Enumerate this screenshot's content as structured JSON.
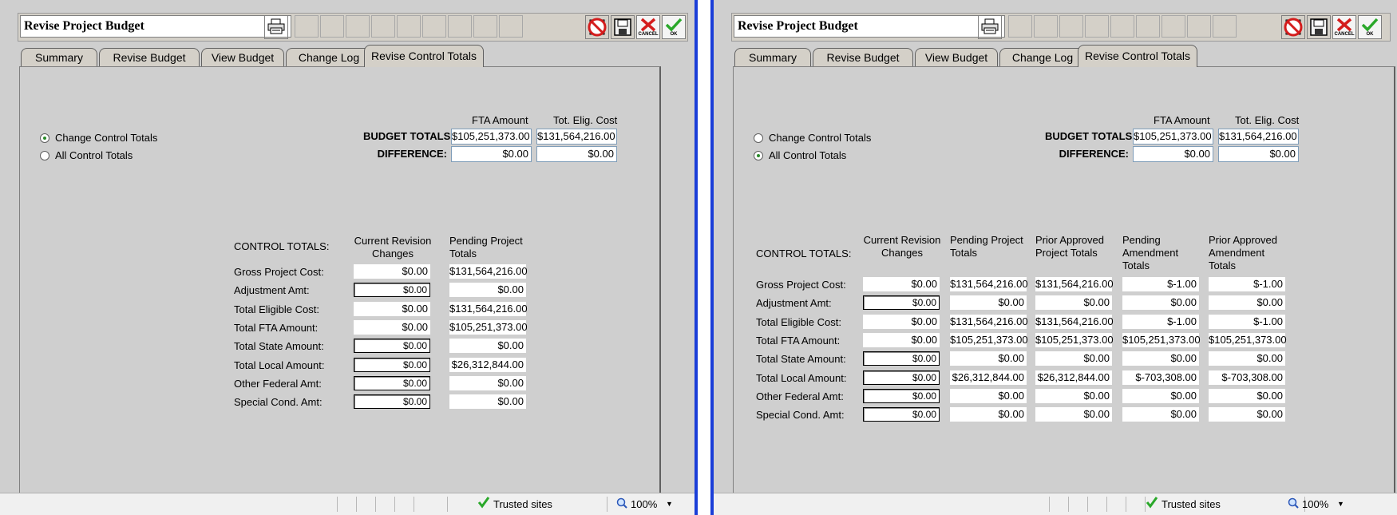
{
  "windows": [
    {
      "title": "Revise Project Budget",
      "tabs": [
        "Summary",
        "Revise Budget",
        "View Budget",
        "Change Log",
        "Revise Control Totals"
      ],
      "active_tab": 4,
      "radios": [
        {
          "label": "Change Control Totals",
          "selected": true
        },
        {
          "label": "All Control Totals",
          "selected": false
        }
      ],
      "budget": {
        "col_fta": "FTA Amount",
        "col_elig": "Tot. Elig. Cost",
        "totals_label": "BUDGET TOTALS:",
        "totals_fta": "$105,251,373.00",
        "totals_elig": "$131,564,216.00",
        "diff_label": "DIFFERENCE:",
        "diff_fta": "$0.00",
        "diff_elig": "$0.00"
      },
      "control": {
        "label": "CONTROL TOTALS:",
        "headers": [
          "Current Revision Changes",
          "Pending Project Totals"
        ],
        "rows": [
          {
            "label": "Gross Project Cost:",
            "values": [
              "$0.00",
              "$131,564,216.00"
            ],
            "editable": false
          },
          {
            "label": "Adjustment Amt:",
            "values": [
              "$0.00",
              "$0.00"
            ],
            "editable": true
          },
          {
            "label": "Total Eligible Cost:",
            "values": [
              "$0.00",
              "$131,564,216.00"
            ],
            "editable": false
          },
          {
            "label": "Total FTA Amount:",
            "values": [
              "$0.00",
              "$105,251,373.00"
            ],
            "editable": false
          },
          {
            "label": "Total State Amount:",
            "values": [
              "$0.00",
              "$0.00"
            ],
            "editable": true
          },
          {
            "label": "Total Local Amount:",
            "values": [
              "$0.00",
              "$26,312,844.00"
            ],
            "editable": true
          },
          {
            "label": "Other Federal Amt:",
            "values": [
              "$0.00",
              "$0.00"
            ],
            "editable": true
          },
          {
            "label": "Special Cond. Amt:",
            "values": [
              "$0.00",
              "$0.00"
            ],
            "editable": true
          }
        ]
      },
      "status": {
        "zone": "Trusted sites",
        "zoom": "100%"
      }
    },
    {
      "title": "Revise Project Budget",
      "tabs": [
        "Summary",
        "Revise Budget",
        "View Budget",
        "Change Log",
        "Revise Control Totals"
      ],
      "active_tab": 4,
      "radios": [
        {
          "label": "Change Control Totals",
          "selected": false
        },
        {
          "label": "All Control Totals",
          "selected": true
        }
      ],
      "budget": {
        "col_fta": "FTA Amount",
        "col_elig": "Tot. Elig. Cost",
        "totals_label": "BUDGET TOTALS:",
        "totals_fta": "$105,251,373.00",
        "totals_elig": "$131,564,216.00",
        "diff_label": "DIFFERENCE:",
        "diff_fta": "$0.00",
        "diff_elig": "$0.00"
      },
      "control": {
        "label": "CONTROL TOTALS:",
        "headers": [
          "Current Revision Changes",
          "Pending Project Totals",
          "Prior Approved Project Totals",
          "Pending Amendment Totals",
          "Prior Approved Amendment Totals"
        ],
        "rows": [
          {
            "label": "Gross Project Cost:",
            "values": [
              "$0.00",
              "$131,564,216.00",
              "$131,564,216.00",
              "$-1.00",
              "$-1.00"
            ],
            "editable": false
          },
          {
            "label": "Adjustment Amt:",
            "values": [
              "$0.00",
              "$0.00",
              "$0.00",
              "$0.00",
              "$0.00"
            ],
            "editable": true
          },
          {
            "label": "Total Eligible Cost:",
            "values": [
              "$0.00",
              "$131,564,216.00",
              "$131,564,216.00",
              "$-1.00",
              "$-1.00"
            ],
            "editable": false
          },
          {
            "label": "Total FTA Amount:",
            "values": [
              "$0.00",
              "$105,251,373.00",
              "$105,251,373.00",
              "$105,251,373.00",
              "$105,251,373.00"
            ],
            "editable": false
          },
          {
            "label": "Total State Amount:",
            "values": [
              "$0.00",
              "$0.00",
              "$0.00",
              "$0.00",
              "$0.00"
            ],
            "editable": true
          },
          {
            "label": "Total Local Amount:",
            "values": [
              "$0.00",
              "$26,312,844.00",
              "$26,312,844.00",
              "$-703,308.00",
              "$-703,308.00"
            ],
            "editable": true
          },
          {
            "label": "Other Federal Amt:",
            "values": [
              "$0.00",
              "$0.00",
              "$0.00",
              "$0.00",
              "$0.00"
            ],
            "editable": true
          },
          {
            "label": "Special Cond. Amt:",
            "values": [
              "$0.00",
              "$0.00",
              "$0.00",
              "$0.00",
              "$0.00"
            ],
            "editable": true
          }
        ]
      },
      "status": {
        "zone": "Trusted sites",
        "zoom": "100%"
      }
    }
  ],
  "icons": {
    "print": "printer-icon",
    "delete": "delete-icon",
    "save": "save-icon",
    "cancel": "cancel-icon",
    "ok": "ok-icon"
  },
  "toolbar_labels": {
    "cancel": "CANCEL",
    "ok": "OK"
  },
  "colors": {
    "window_bg": "#cfcfcf",
    "frame_border": "#1a3ed8",
    "ok_green": "#2aa82a",
    "cancel_red": "#d41c1c"
  }
}
